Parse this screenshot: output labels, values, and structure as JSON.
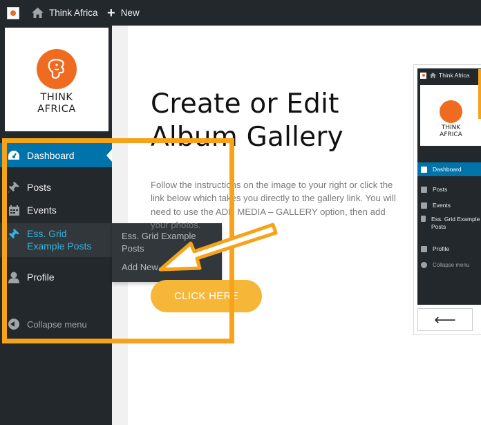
{
  "adminbar": {
    "site_name": "Think Africa",
    "new_label": "New"
  },
  "sidebar": {
    "logo_line1": "THINK",
    "logo_line2": "AFRICA",
    "items": [
      {
        "label": "Dashboard"
      },
      {
        "label": "Posts"
      },
      {
        "label": "Events"
      },
      {
        "label": "Ess. Grid Example Posts"
      },
      {
        "label": "Profile"
      },
      {
        "label": "Collapse menu"
      }
    ],
    "flyout": {
      "item1": "Ess. Grid Example Posts",
      "item2": "Add New"
    }
  },
  "main": {
    "heading": "Create or Edit Album Gallery",
    "paragraph": "Follow the instructions on the image to your right or click the link below which takes you directly to the gallery link. You will need to use the ADD MEDIA – GALLERY option, then add your photos.",
    "cta_label": "CLICK HERE"
  },
  "mini": {
    "site_name": "Think Africa",
    "logo_line1": "THINK",
    "logo_line2": "AFRICA",
    "items": [
      "Dashboard",
      "Posts",
      "Events",
      "Ess. Grid Example Posts",
      "Profile",
      "Collapse menu"
    ],
    "back_glyph": "⟵"
  },
  "colors": {
    "admin_dark": "#23282d",
    "active_blue": "#0073aa",
    "highlight_text": "#33b3db",
    "annotation_orange": "#f6a31a",
    "cta_yellow": "#f6b739",
    "brand_orange": "#ef6b1f"
  }
}
